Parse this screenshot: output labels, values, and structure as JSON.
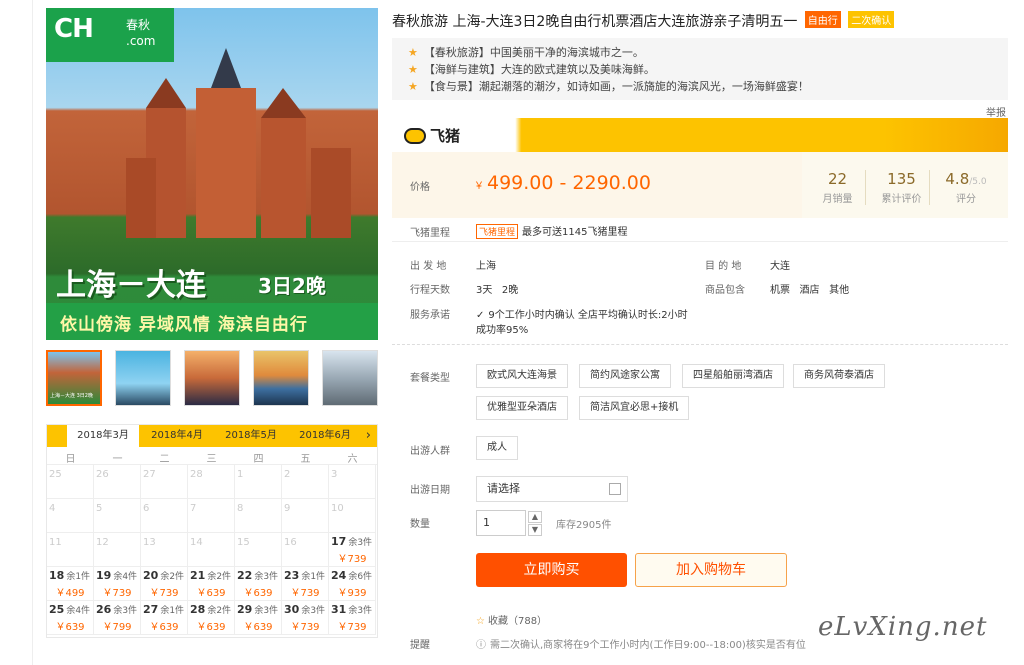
{
  "gallery": {
    "logo_text": "CH",
    "logo_cn": "春秋",
    "logo_url": ".com",
    "banner_title": "上海－大连",
    "banner_days": "3日2晚",
    "banner_slogan": "依山傍海  异域风情  海滨自由行",
    "thumb_caption": "上海－大连 3日2晚"
  },
  "calendar": {
    "tabs": [
      "2018年3月",
      "2018年4月",
      "2018年5月",
      "2018年6月"
    ],
    "next": "›",
    "weekdays": [
      "日",
      "一",
      "二",
      "三",
      "四",
      "五",
      "六"
    ],
    "rows": [
      [
        {
          "d": "25"
        },
        {
          "d": "26"
        },
        {
          "d": "27"
        },
        {
          "d": "28"
        },
        {
          "d": "1"
        },
        {
          "d": "2"
        },
        {
          "d": "3"
        }
      ],
      [
        {
          "d": "4"
        },
        {
          "d": "5"
        },
        {
          "d": "6"
        },
        {
          "d": "7"
        },
        {
          "d": "8"
        },
        {
          "d": "9"
        },
        {
          "d": "10"
        }
      ],
      [
        {
          "d": "11"
        },
        {
          "d": "12"
        },
        {
          "d": "13"
        },
        {
          "d": "14"
        },
        {
          "d": "15"
        },
        {
          "d": "16"
        },
        {
          "d": "17",
          "r": "余3件",
          "p": "￥739"
        }
      ],
      [
        {
          "d": "18",
          "r": "余1件",
          "p": "￥499"
        },
        {
          "d": "19",
          "r": "余4件",
          "p": "￥739"
        },
        {
          "d": "20",
          "r": "余2件",
          "p": "￥739"
        },
        {
          "d": "21",
          "r": "余2件",
          "p": "￥639"
        },
        {
          "d": "22",
          "r": "余3件",
          "p": "￥639"
        },
        {
          "d": "23",
          "r": "余1件",
          "p": "￥739"
        },
        {
          "d": "24",
          "r": "余6件",
          "p": "￥939"
        }
      ],
      [
        {
          "d": "25",
          "r": "余4件",
          "p": "￥639"
        },
        {
          "d": "26",
          "r": "余3件",
          "p": "￥799"
        },
        {
          "d": "27",
          "r": "余1件",
          "p": "￥639"
        },
        {
          "d": "28",
          "r": "余2件",
          "p": "￥639"
        },
        {
          "d": "29",
          "r": "余3件",
          "p": "￥639"
        },
        {
          "d": "30",
          "r": "余3件",
          "p": "￥739"
        },
        {
          "d": "31",
          "r": "余3件",
          "p": "￥739"
        }
      ]
    ]
  },
  "product": {
    "title": "春秋旅游 上海-大连3日2晚自由行机票酒店大连旅游亲子清明五一",
    "tag1": "自由行",
    "tag2": "二次确认",
    "highlights": [
      "【春秋旅游】中国美丽干净的海滨城市之一。",
      "【海鲜与建筑】大连的欧式建筑以及美味海鲜。",
      "【食与景】潮起潮落的潮汐，如诗如画，一派旖旎的海滨风光，一场海鲜盛宴！"
    ],
    "report": "举报"
  },
  "brand": {
    "name": "飞猪"
  },
  "price": {
    "label": "价格",
    "currency": "￥",
    "range": "499.00 - 2290.00",
    "stats": [
      {
        "n": "22",
        "l": "月销量"
      },
      {
        "n": "135",
        "l": "累计评价"
      },
      {
        "n": "4.8",
        "sub": "/5.0",
        "l": "评分"
      }
    ]
  },
  "miles": {
    "label": "飞猪里程",
    "tag": "飞猪里程",
    "text": "最多可送1145飞猪里程"
  },
  "info": {
    "from_label": "出 发 地",
    "from": "上海",
    "dest_label": "目 的 地",
    "dest": "大连",
    "days_label": "行程天数",
    "days": "3天   2晚",
    "includes_label": "商品包含",
    "includes": "机票   酒店   其他",
    "service_label": "服务承诺",
    "service": "9个工作小时内确认  全店平均确认时长:2小时",
    "service2": "成功率95%"
  },
  "options": {
    "package_label": "套餐类型",
    "packages": [
      "欧式风大连海景",
      "简约风途家公寓",
      "四星船舶丽湾酒店",
      "商务风荷泰酒店",
      "优雅型亚朵酒店",
      "简洁风宜必思+接机"
    ],
    "people_label": "出游人群",
    "people": "成人",
    "date_label": "出游日期",
    "date_placeholder": "请选择",
    "qty_label": "数量",
    "qty": "1",
    "stock": "库存2905件",
    "buy": "立即购买",
    "cart": "加入购物车",
    "fav": "收藏（788）",
    "note_label": "提醒",
    "note": "需二次确认,商家将在9个工作小时内(工作日9:00--18:00)核实是否有位"
  },
  "watermark": "eLvXing.net"
}
